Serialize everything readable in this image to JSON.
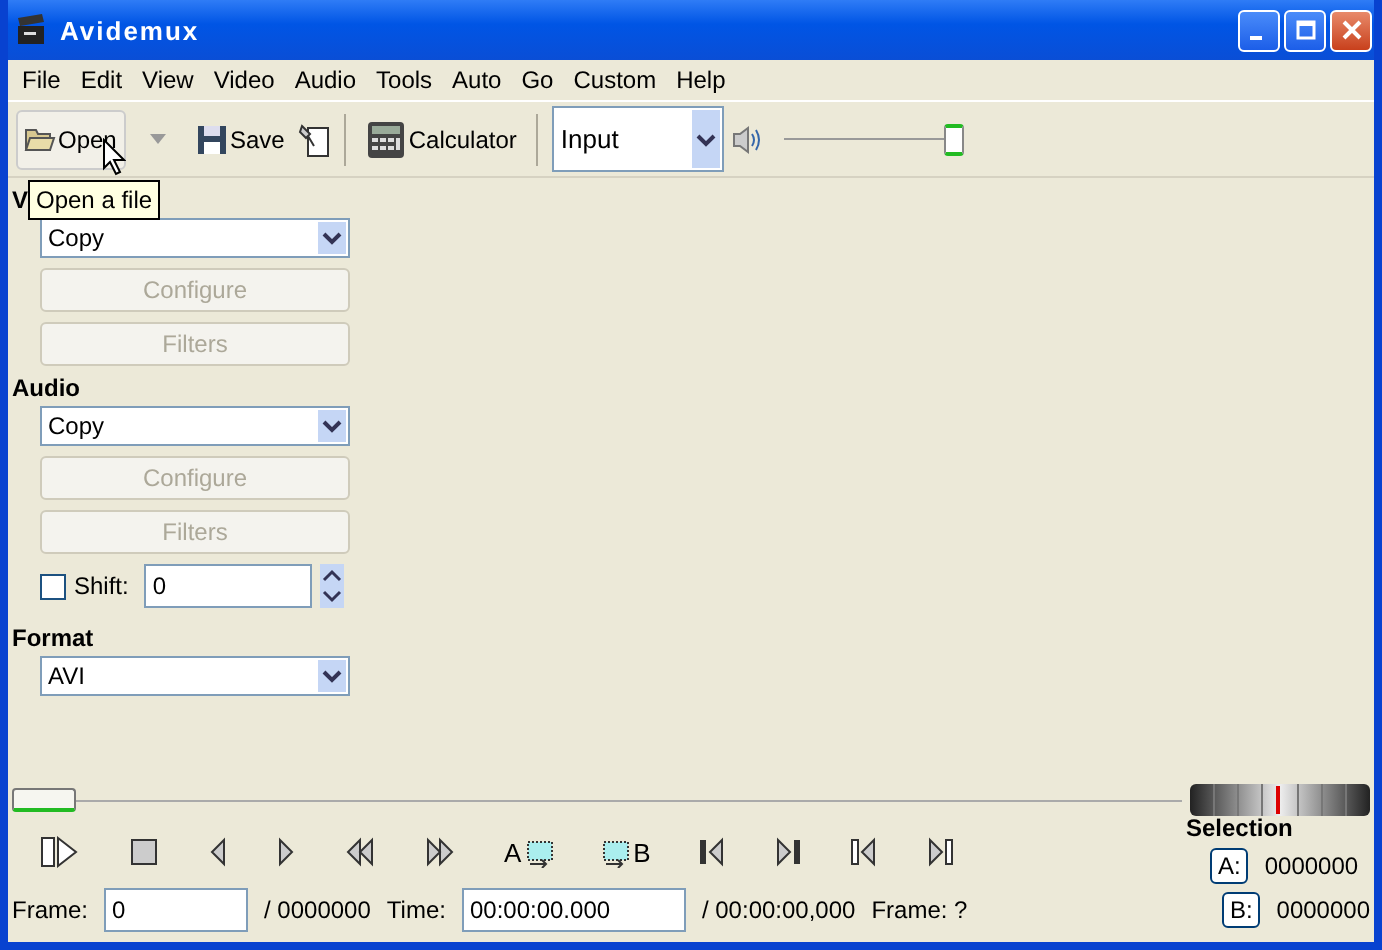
{
  "window": {
    "title": "Avidemux"
  },
  "menu": [
    "File",
    "Edit",
    "View",
    "Video",
    "Audio",
    "Tools",
    "Auto",
    "Go",
    "Custom",
    "Help"
  ],
  "toolbar": {
    "open": "Open",
    "save": "Save",
    "calculator": "Calculator",
    "input_select": "Input",
    "volume": {
      "level": 1.0
    }
  },
  "tooltip": "Open a file",
  "video": {
    "label": "V",
    "codec": "Copy",
    "configure": {
      "label": "Configure",
      "disabled": true
    },
    "filters": {
      "label": "Filters",
      "disabled": true
    }
  },
  "audio": {
    "label": "Audio",
    "codec": "Copy",
    "configure": {
      "label": "Configure",
      "disabled": true
    },
    "filters": {
      "label": "Filters",
      "disabled": true
    },
    "shift": {
      "label": "Shift:",
      "checked": false,
      "value": "0"
    }
  },
  "format": {
    "label": "Format",
    "value": "AVI"
  },
  "timeline": {
    "level": 0.0
  },
  "controls": [
    {
      "kind": "play"
    },
    {
      "kind": "stop"
    },
    {
      "kind": "prev"
    },
    {
      "kind": "next"
    },
    {
      "kind": "rewind"
    },
    {
      "kind": "forward"
    },
    {
      "kind": "mark_a",
      "label": "A"
    },
    {
      "kind": "mark_b",
      "label": "B"
    },
    {
      "kind": "goto_a"
    },
    {
      "kind": "goto_b"
    },
    {
      "kind": "prev_key"
    },
    {
      "kind": "next_key"
    }
  ],
  "status": {
    "frame_label": "Frame:",
    "frame": "0",
    "frame_total": "/ 0000000",
    "time_label": "Time:",
    "time": "00:00:00.000",
    "time_total": "/ 00:00:00,000",
    "frame_type": "Frame: ?"
  },
  "selection": {
    "title": "Selection",
    "a": {
      "label": "A:",
      "value": "0000000"
    },
    "b": {
      "label": "B:",
      "value": "0000000"
    }
  }
}
